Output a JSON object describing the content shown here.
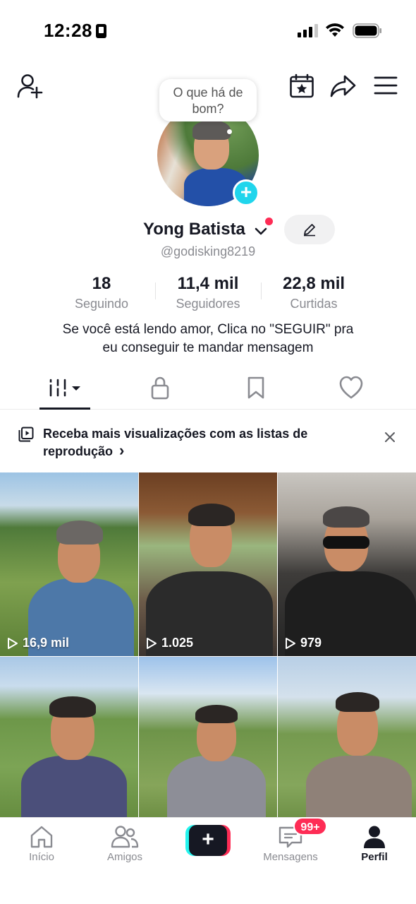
{
  "status_bar": {
    "time": "12:28"
  },
  "profile": {
    "bubble_text": "O que há de bom?",
    "name": "Yong Batista",
    "handle": "@godisking8219",
    "stats": [
      {
        "value": "18",
        "label": "Seguindo"
      },
      {
        "value": "11,4 mil",
        "label": "Seguidores"
      },
      {
        "value": "22,8 mil",
        "label": "Curtidas"
      }
    ],
    "bio_line1": "Se você está lendo amor, Clica no \"SEGUIR\" pra",
    "bio_line2": "eu conseguir te mandar mensagem"
  },
  "banner": {
    "text": "Receba mais visualizações com as listas de reprodução",
    "chevron": "›"
  },
  "videos": [
    {
      "views": "16,9 mil"
    },
    {
      "views": "1.025"
    },
    {
      "views": "979"
    },
    {
      "views": ""
    },
    {
      "views": ""
    },
    {
      "views": ""
    }
  ],
  "bottom_nav": {
    "home": "Início",
    "friends": "Amigos",
    "messages": "Mensagens",
    "profile": "Perfil",
    "messages_badge": "99+"
  },
  "colors": {
    "accent_red": "#fe2c55",
    "accent_cyan": "#20d5ec",
    "text_primary": "#161823",
    "text_secondary": "#8a8b91"
  }
}
